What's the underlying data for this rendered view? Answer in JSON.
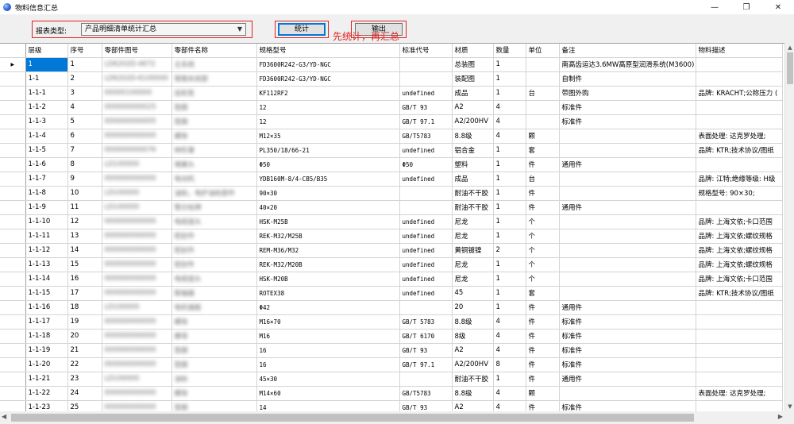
{
  "window": {
    "title": "物料信息汇总",
    "minimize": "—",
    "restore": "❐",
    "close": "✕"
  },
  "toolbar": {
    "type_label": "报表类型:",
    "type_value": "产品明细清单统计汇总",
    "stat_button": "统计",
    "export_button": "输出",
    "hint": "先统计，再汇总"
  },
  "columns": [
    "层级",
    "序号",
    "零部件图号",
    "零部件名称",
    "规格型号",
    "标准代号",
    "材质",
    "数量",
    "单位",
    "备注",
    "物料描述"
  ],
  "rows": [
    [
      "1",
      "1",
      "LD6202D-4672",
      "主系统",
      "FD3600R242-G3/YD-NGC",
      "",
      "总装图",
      "1",
      "",
      "南高齿运达3.6MW高原型润滑系统(M3600)",
      ""
    ],
    [
      "1-1",
      "2",
      "LD6202D-6100000",
      "管路系统部",
      "FD3600R242-G3/YD-NGC",
      "",
      "装配图",
      "1",
      "",
      "自制件",
      ""
    ],
    [
      "1-1-1",
      "3",
      "00000100000",
      "齿轮泵",
      "KF112RF2",
      "undefined",
      "成品",
      "1",
      "台",
      "带图外购",
      "品牌: KRACHT;公称压力 ("
    ],
    [
      "1-1-2",
      "4",
      "000000000025",
      "垫圈",
      "12",
      "GB/T 93",
      "A2",
      "4",
      "",
      "标准件",
      ""
    ],
    [
      "1-1-3",
      "5",
      "000000000005",
      "垫圈",
      "12",
      "GB/T 97.1",
      "A2/200HV",
      "4",
      "",
      "标准件",
      ""
    ],
    [
      "1-1-4",
      "6",
      "000000000000",
      "螺栓",
      "M12×35",
      "GB/T5783",
      "8.8级",
      "4",
      "颗",
      "",
      "表面处理: 达克罗处理;"
    ],
    [
      "1-1-5",
      "7",
      "000000000076",
      "钟形罩",
      "PL350/18/66-21",
      "undefined",
      "铝合金",
      "1",
      "套",
      "",
      "品牌: KTR;技术协议/图纸"
    ],
    [
      "1-1-6",
      "8",
      "LD100000",
      "堵塞头",
      "Φ50",
      "Φ50",
      "塑料",
      "1",
      "件",
      "通用件",
      ""
    ],
    [
      "1-1-7",
      "9",
      "000000000000",
      "电动机",
      "YDB160M-8/4-CB5/B35",
      "undefined",
      "成品",
      "1",
      "台",
      "",
      "品牌: 江特;绝缘等级: H级"
    ],
    [
      "1-1-8",
      "10",
      "LD100000",
      "油标，电护油标部件",
      "90×30",
      "",
      "耐油不干胶",
      "1",
      "件",
      "",
      "规格型号: 90×30;"
    ],
    [
      "1-1-9",
      "11",
      "LD100000",
      "警示标牌",
      "40×20",
      "",
      "耐油不干胶",
      "1",
      "件",
      "通用件",
      ""
    ],
    [
      "1-1-10",
      "12",
      "000000000000",
      "电缆接头",
      "HSK-M25B",
      "undefined",
      "尼龙",
      "1",
      "个",
      "",
      "品牌: 上海文依;卡口范围"
    ],
    [
      "1-1-11",
      "13",
      "000000000000",
      "密封件",
      "REK-M32/M25B",
      "undefined",
      "尼龙",
      "1",
      "个",
      "",
      "品牌: 上海文依;螺纹规格"
    ],
    [
      "1-1-12",
      "14",
      "000000000000",
      "密封件",
      "REM-M36/M32",
      "undefined",
      "黄铜镀镍",
      "2",
      "个",
      "",
      "品牌: 上海文依;螺纹规格"
    ],
    [
      "1-1-13",
      "15",
      "000000000000",
      "密封件",
      "REK-M32/M20B",
      "undefined",
      "尼龙",
      "1",
      "个",
      "",
      "品牌: 上海文依;螺纹规格"
    ],
    [
      "1-1-14",
      "16",
      "000000000000",
      "电缆接头",
      "HSK-M20B",
      "undefined",
      "尼龙",
      "1",
      "个",
      "",
      "品牌: 上海文依;卡口范围"
    ],
    [
      "1-1-15",
      "17",
      "000000000000",
      "联轴器",
      "ROTEX38",
      "undefined",
      "45",
      "1",
      "套",
      "",
      "品牌: KTR;技术协议/图纸"
    ],
    [
      "1-1-16",
      "18",
      "LD100000",
      "电机端板",
      "Φ42",
      "",
      "20",
      "1",
      "件",
      "通用件",
      ""
    ],
    [
      "1-1-17",
      "19",
      "000000000000",
      "螺栓",
      "M16×70",
      "GB/T 5783",
      "8.8级",
      "4",
      "件",
      "标准件",
      ""
    ],
    [
      "1-1-18",
      "20",
      "000000000000",
      "螺母",
      "M16",
      "GB/T 6170",
      "8级",
      "4",
      "件",
      "标准件",
      ""
    ],
    [
      "1-1-19",
      "21",
      "000000000000",
      "垫圈",
      "16",
      "GB/T 93",
      "A2",
      "4",
      "件",
      "标准件",
      ""
    ],
    [
      "1-1-20",
      "22",
      "000000000000",
      "垫圈",
      "16",
      "GB/T 97.1",
      "A2/200HV",
      "8",
      "件",
      "标准件",
      ""
    ],
    [
      "1-1-21",
      "23",
      "LD100000",
      "油标",
      "45×30",
      "",
      "耐油不干胶",
      "1",
      "件",
      "通用件",
      ""
    ],
    [
      "1-1-22",
      "24",
      "000000000000",
      "螺栓",
      "M14×60",
      "GB/T5783",
      "8.8级",
      "4",
      "颗",
      "",
      "表面处理: 达克罗处理;"
    ],
    [
      "1-1-23",
      "25",
      "000000000000",
      "垫圈",
      "14",
      "GB/T 93",
      "A2",
      "4",
      "件",
      "标准件",
      ""
    ]
  ]
}
